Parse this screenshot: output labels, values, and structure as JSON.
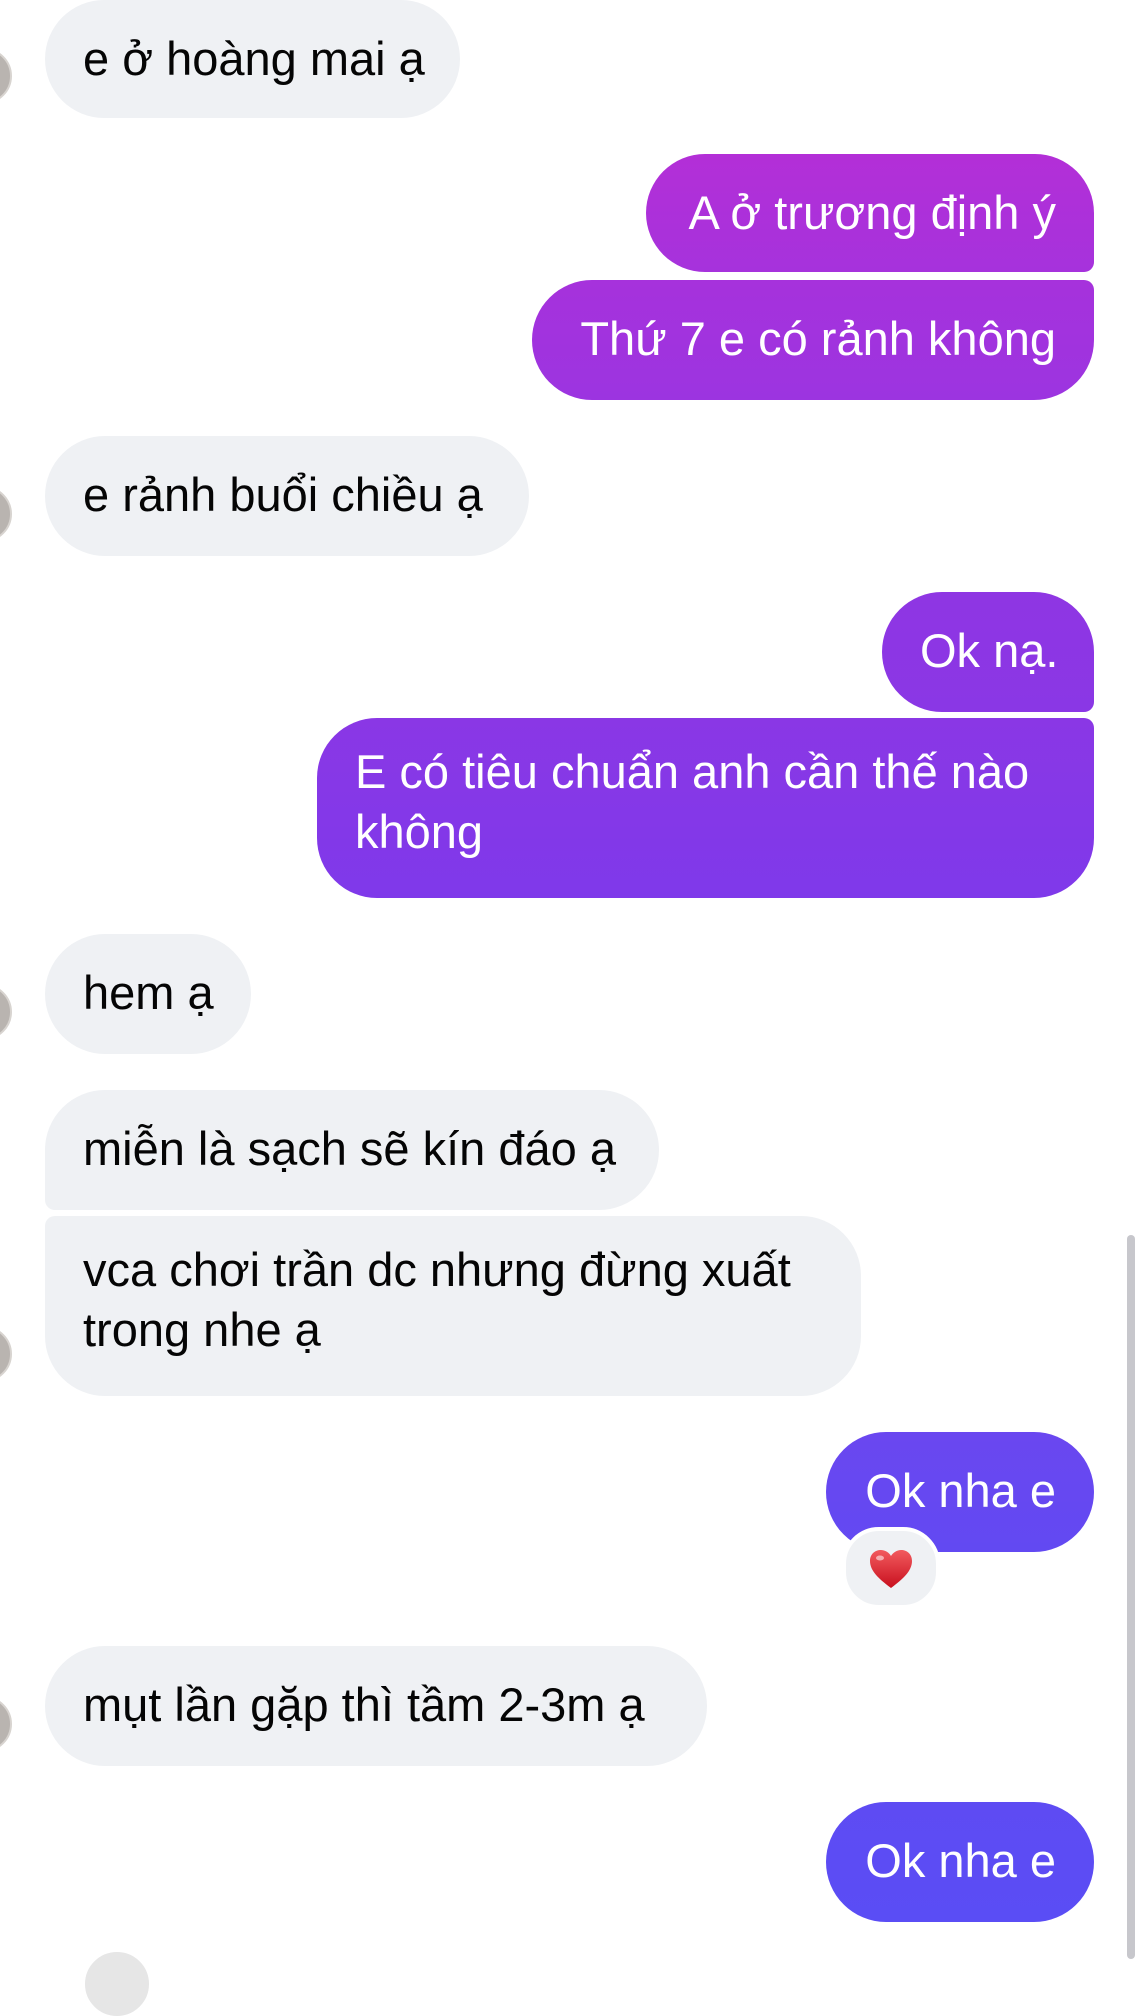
{
  "colors": {
    "incoming_bubble": "#eff1f4",
    "outgoing_gradient_top": "#b32fd7",
    "outgoing_gradient_bottom": "#5a4df5",
    "reaction_heart": "#e0242f"
  },
  "messages": [
    {
      "direction": "incoming",
      "text": "e ở hoàng mai ạ"
    },
    {
      "direction": "outgoing",
      "text": "A ở trương định ý"
    },
    {
      "direction": "outgoing",
      "text": "Thứ 7 e có rảnh không"
    },
    {
      "direction": "incoming",
      "text": "e rảnh buổi chiều ạ"
    },
    {
      "direction": "outgoing",
      "text": "Ok nạ."
    },
    {
      "direction": "outgoing",
      "text": "E có tiêu chuẩn anh cần thế nào không"
    },
    {
      "direction": "incoming",
      "text": "hem ạ"
    },
    {
      "direction": "incoming",
      "text": "miễn là sạch sẽ kín đáo ạ"
    },
    {
      "direction": "incoming",
      "text": "vca chơi trần dc nhưng đừng xuất trong nhe ạ"
    },
    {
      "direction": "outgoing",
      "text": "Ok nha e",
      "reaction": "heart-icon"
    },
    {
      "direction": "incoming",
      "text": "mụt lần gặp thì tầm 2-3m ạ"
    },
    {
      "direction": "outgoing",
      "text": "Ok nha e"
    }
  ]
}
